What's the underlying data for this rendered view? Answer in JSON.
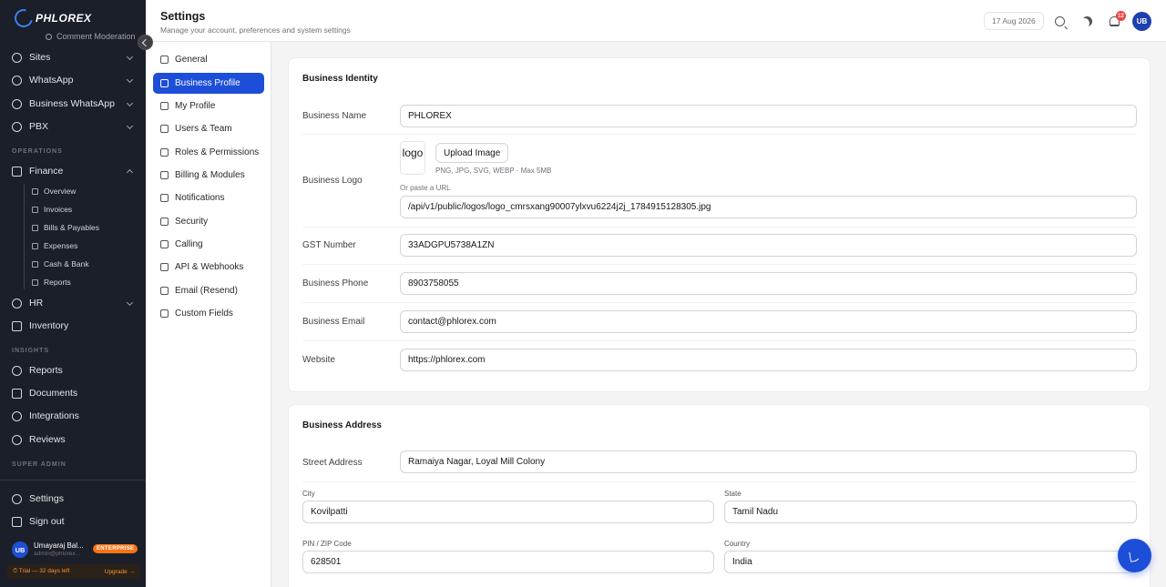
{
  "brand": {
    "logo_text": "PHLOREX"
  },
  "sidebar": {
    "partial_item": "Comment Moderation",
    "items_top": [
      {
        "label": "Sites"
      },
      {
        "label": "WhatsApp"
      },
      {
        "label": "Business WhatsApp"
      },
      {
        "label": "PBX"
      }
    ],
    "section_operations": "OPERATIONS",
    "finance": {
      "label": "Finance",
      "children": [
        "Overview",
        "Invoices",
        "Bills & Payables",
        "Expenses",
        "Cash & Bank",
        "Reports"
      ]
    },
    "hr": "HR",
    "inventory": "Inventory",
    "section_insights": "INSIGHTS",
    "insights_items": [
      "Reports",
      "Documents",
      "Integrations",
      "Reviews"
    ],
    "section_super_admin": "SUPER ADMIN",
    "settings": "Settings",
    "sign_out": "Sign out",
    "user": {
      "initials": "UB",
      "name": "Umayaraj Bal...",
      "email": "admin@phlorex...",
      "plan_badge": "ENTERPRISE"
    },
    "trial_text": "⏱ Trial — 32 days left",
    "upgrade_text": "Upgrade →"
  },
  "header": {
    "title": "Settings",
    "subtitle": "Manage your account, preferences and system settings",
    "date": "17 Aug 2026",
    "notification_count": "12",
    "avatar_initials": "UB"
  },
  "settings_nav": {
    "items": [
      {
        "label": "General",
        "icon": "building-icon"
      },
      {
        "label": "Business Profile",
        "icon": "briefcase-icon",
        "active": true
      },
      {
        "label": "My Profile",
        "icon": "user-icon"
      },
      {
        "label": "Users & Team",
        "icon": "users-icon"
      },
      {
        "label": "Roles & Permissions",
        "icon": "shield-check-icon"
      },
      {
        "label": "Billing & Modules",
        "icon": "credit-card-icon"
      },
      {
        "label": "Notifications",
        "icon": "bell-icon"
      },
      {
        "label": "Security",
        "icon": "shield-icon"
      },
      {
        "label": "Calling",
        "icon": "phone-icon"
      },
      {
        "label": "API & Webhooks",
        "icon": "webhook-icon"
      },
      {
        "label": "Email (Resend)",
        "icon": "mail-icon"
      },
      {
        "label": "Custom Fields",
        "icon": "layers-icon"
      }
    ]
  },
  "business_identity": {
    "title": "Business Identity",
    "name_label": "Business Name",
    "name_value": "PHLOREX",
    "logo_label": "Business Logo",
    "logo_preview_text": "logo",
    "upload_button": "Upload Image",
    "logo_hint": "PNG, JPG, SVG, WEBP · Max 5MB",
    "url_hint": "Or paste a URL",
    "logo_url": "/api/v1/public/logos/logo_cmrsxang90007ylxvu6224j2j_1784915128305.jpg",
    "gst_label": "GST Number",
    "gst_value": "33ADGPU5738A1ZN",
    "phone_label": "Business Phone",
    "phone_value": "8903758055",
    "email_label": "Business Email",
    "email_value": "contact@phlorex.com",
    "website_label": "Website",
    "website_value": "https://phlorex.com"
  },
  "business_address": {
    "title": "Business Address",
    "street_label": "Street Address",
    "street_value": "Ramaiya Nagar, Loyal Mill Colony",
    "city_label": "City",
    "city_value": "Kovilpatti",
    "state_label": "State",
    "state_value": "Tamil Nadu",
    "pin_label": "PIN / ZIP Code",
    "pin_value": "628501",
    "country_label": "Country",
    "country_value": "India"
  },
  "colors": {
    "accent": "#1d4ed8",
    "sidebar_bg": "#1b1f2a",
    "badge": "#f97316",
    "notif": "#ef4444"
  }
}
